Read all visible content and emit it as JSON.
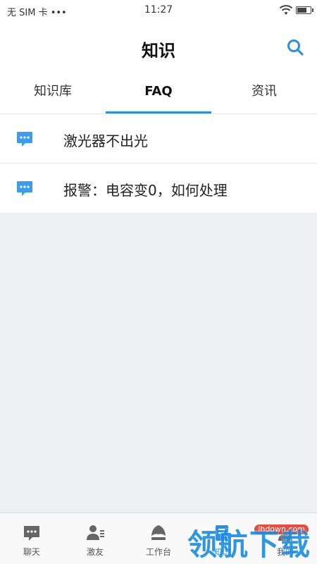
{
  "status": {
    "sim": "无 SIM 卡 •••",
    "time": "11:27"
  },
  "header": {
    "title": "知识",
    "search_icon": "search-icon"
  },
  "tabs": [
    {
      "label": "知识库",
      "active": false
    },
    {
      "label": "FAQ",
      "active": true
    },
    {
      "label": "资讯",
      "active": false
    }
  ],
  "faq_items": [
    {
      "label": "激光器不出光",
      "icon": "chat-bubble-icon"
    },
    {
      "label": "报警：电容变0，如何处理",
      "icon": "chat-bubble-icon"
    }
  ],
  "tabbar": [
    {
      "label": "聊天",
      "icon": "chat-icon"
    },
    {
      "label": "激友",
      "icon": "contacts-icon"
    },
    {
      "label": "工作台",
      "icon": "workbench-icon"
    },
    {
      "label": "知识",
      "icon": "knowledge-icon"
    },
    {
      "label": "我的",
      "icon": "profile-icon"
    }
  ],
  "watermark": {
    "text": "领航下载",
    "url": "lhdown.com"
  },
  "colors": {
    "accent": "#2d8fe3",
    "icon_blue": "#3b9cf0"
  }
}
